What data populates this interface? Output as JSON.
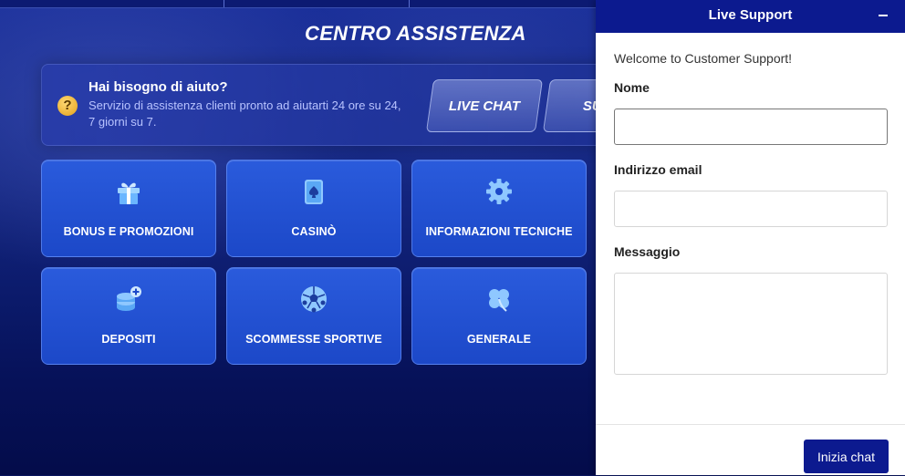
{
  "page": {
    "title": "CENTRO ASSISTENZA",
    "help": {
      "icon": "question-icon",
      "icon_glyph": "?",
      "title": "Hai bisogno di aiuto?",
      "text": "Servizio di assistenza clienti pronto ad aiutarti 24 ore su 24, 7 giorni su 7."
    },
    "buttons": {
      "live_chat": "LIVE CHAT",
      "support": "SUPP"
    },
    "categories": [
      {
        "label": "BONUS E PROMOZIONI",
        "icon": "gift-icon"
      },
      {
        "label": "CASINÒ",
        "icon": "playing-card-icon"
      },
      {
        "label": "INFORMAZIONI TECNICHE",
        "icon": "gear-icon"
      },
      {
        "label": "DEPOSITI",
        "icon": "coins-add-icon"
      },
      {
        "label": "SCOMMESSE SPORTIVE",
        "icon": "soccer-ball-icon"
      },
      {
        "label": "GENERALE",
        "icon": "clover-icon"
      }
    ]
  },
  "chat": {
    "title": "Live Support",
    "minimize_icon": "minimize-icon",
    "welcome": "Welcome to Customer Support!",
    "fields": {
      "name": {
        "label": "Nome",
        "value": ""
      },
      "email": {
        "label": "Indirizzo email",
        "value": ""
      },
      "message": {
        "label": "Messaggio",
        "value": ""
      }
    },
    "submit_label": "Inizia chat"
  },
  "colors": {
    "chat_header": "#0c1a8f",
    "card_blue": "#2a5bdc",
    "page_bg": "#0a1660",
    "help_icon": "#f2b632"
  }
}
